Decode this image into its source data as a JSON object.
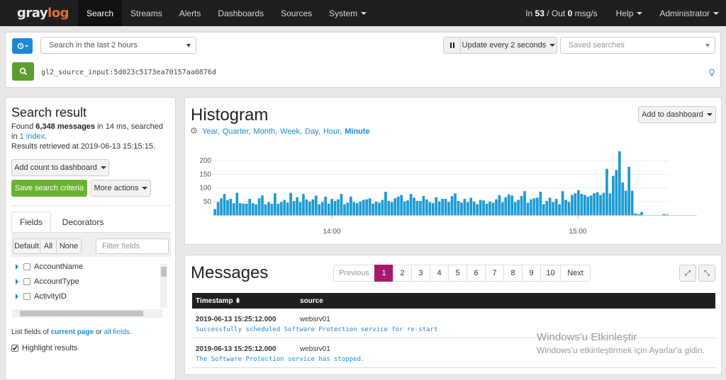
{
  "nav": {
    "logo_part1": "gray",
    "logo_part2": "log",
    "items": [
      "Search",
      "Streams",
      "Alerts",
      "Dashboards",
      "Sources",
      "System"
    ],
    "throughput_prefix": "In ",
    "throughput_in": "53",
    "throughput_mid": " / Out ",
    "throughput_out": "0",
    "throughput_suffix": " msg/s",
    "help": "Help",
    "user": "Administrator"
  },
  "searchbar": {
    "range_value": "Search in the last 2 hours",
    "update_label": "Update every 2 seconds",
    "saved_placeholder": "Saved searches",
    "query": "gl2_source_input:5d023c5173ea70157aa0876d"
  },
  "search_result": {
    "title": "Search result",
    "found_prefix": "Found ",
    "count": "6,348 messages",
    "found_mid": " in 14 ms, searched",
    "in_prefix": "in ",
    "index_link": "1 index",
    "in_suffix": ".",
    "retrieved": "Results retrieved at 2019-06-13 15:15:15.",
    "add_count_label": "Add count to dashboard",
    "save_label": "Save search criteria",
    "more_label": "More actions"
  },
  "fields_panel": {
    "tab_fields": "Fields",
    "tab_decorators": "Decorators",
    "btn_default": "Default",
    "btn_all": "All",
    "btn_none": "None",
    "filter_placeholder": "Filter fields",
    "items": [
      "AccountName",
      "AccountType",
      "ActivityID"
    ],
    "list_prefix": "List fields of ",
    "current_page_link": "current page",
    "list_mid": " or ",
    "all_fields_link": "all fields",
    "list_suffix": ".",
    "highlight_label": "Highlight results"
  },
  "histogram": {
    "title": "Histogram",
    "add_to_dashboard": "Add to dashboard",
    "resolutions": [
      "Year,",
      "Quarter,",
      "Month,",
      "Week,",
      "Day,",
      "Hour,",
      "Minute"
    ],
    "active_resolution": "Minute"
  },
  "chart_data": {
    "type": "bar",
    "ylim": [
      0,
      250
    ],
    "yticks": [
      50,
      100,
      150,
      200
    ],
    "xticks": [
      "14:00",
      "15:00"
    ],
    "color": "#1a9ad6",
    "values": [
      22,
      48,
      62,
      78,
      55,
      60,
      44,
      82,
      44,
      42,
      42,
      60,
      44,
      40,
      62,
      72,
      40,
      48,
      42,
      80,
      42,
      48,
      56,
      46,
      82,
      52,
      66,
      48,
      78,
      58,
      50,
      58,
      72,
      40,
      48,
      68,
      42,
      60,
      52,
      58,
      78,
      40,
      46,
      68,
      48,
      44,
      50,
      56,
      58,
      62,
      42,
      50,
      46,
      56,
      86,
      52,
      48,
      62,
      68,
      74,
      50,
      54,
      78,
      64,
      52,
      52,
      70,
      58,
      48,
      44,
      66,
      50,
      60,
      60,
      48,
      70,
      80,
      52,
      46,
      60,
      48,
      64,
      50,
      40,
      56,
      54,
      42,
      50,
      46,
      58,
      74,
      48,
      66,
      76,
      72,
      48,
      56,
      70,
      88,
      46,
      58,
      62,
      64,
      86,
      40,
      52,
      64,
      48,
      60,
      40,
      88,
      56,
      48,
      74,
      80,
      92,
      78,
      74,
      68,
      72,
      80,
      84,
      74,
      82,
      170,
      80,
      144,
      166,
      235,
      120,
      90,
      178,
      90,
      6,
      4,
      12,
      0,
      0,
      0,
      0,
      0,
      0,
      4,
      2
    ]
  },
  "messages": {
    "title": "Messages",
    "pages": [
      "Previous",
      "1",
      "2",
      "3",
      "4",
      "5",
      "6",
      "7",
      "8",
      "9",
      "10",
      "Next"
    ],
    "col_timestamp": "Timestamp",
    "col_source": "source",
    "rows": [
      {
        "timestamp": "2019-06-13 15:25:12.000",
        "source": "websrv01",
        "message": "Successfully scheduled Software Protection service for re-start"
      },
      {
        "timestamp": "2019-06-13 15:25:12.000",
        "source": "websrv01",
        "message": "The Software Protection service has stopped."
      }
    ]
  },
  "watermark": {
    "line1": "Windows'u Etkinleştir",
    "line2": "Windows'u etkinleştirmek için Ayarlar'a gidin."
  }
}
